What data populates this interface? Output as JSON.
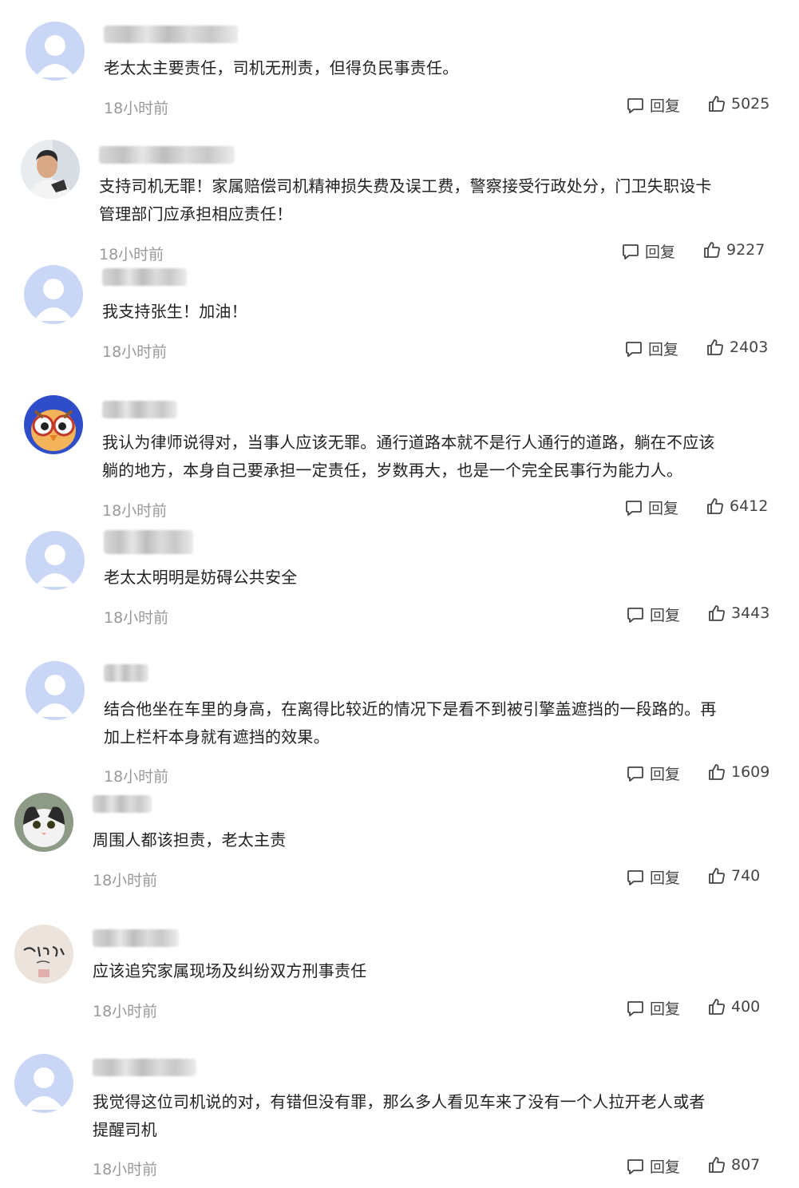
{
  "labels": {
    "reply": "回复"
  },
  "colors": {
    "avatar_default_bg": "#c9d6f5",
    "avatar_default_fg": "#ffffff",
    "time": "#999999",
    "text": "#222222"
  },
  "comments": [
    {
      "avatar": "default-avatar-icon",
      "text_lines": [
        "老太太主要责任，司机无刑责，但得负民事责任。"
      ],
      "time": "18小时前",
      "likes": "5025"
    },
    {
      "avatar": "man-photo-avatar",
      "text_lines": [
        "支持司机无罪！家属赔偿司机精神损失费及误工费，警察接受行政处分，门卫失职设卡",
        "管理部门应承担相应责任！"
      ],
      "time": "18小时前",
      "likes": "9227"
    },
    {
      "avatar": "default-avatar-icon",
      "text_lines": [
        "我支持张生！加油！"
      ],
      "time": "18小时前",
      "likes": "2403"
    },
    {
      "avatar": "owl-cartoon-avatar",
      "text_lines": [
        "我认为律师说得对，当事人应该无罪。通行道路本就不是行人通行的道路，躺在不应该",
        "躺的地方，本身自己要承担一定责任，岁数再大，也是一个完全民事行为能力人。"
      ],
      "time": "18小时前",
      "likes": "6412"
    },
    {
      "avatar": "default-avatar-icon",
      "text_lines": [
        "老太太明明是妨碍公共安全"
      ],
      "time": "18小时前",
      "likes": "3443"
    },
    {
      "avatar": "default-avatar-icon",
      "text_lines": [
        "结合他坐在车里的身高，在离得比较近的情况下是看不到被引擎盖遮挡的一段路的。再",
        "加上栏杆本身就有遮挡的效果。"
      ],
      "time": "18小时前",
      "likes": "1609"
    },
    {
      "avatar": "cat-photo-avatar",
      "text_lines": [
        "周围人都该担责，老太主责"
      ],
      "time": "18小时前",
      "likes": "740"
    },
    {
      "avatar": "handwriting-avatar",
      "text_lines": [
        "应该追究家属现场及纠纷双方刑事责任"
      ],
      "time": "18小时前",
      "likes": "400"
    },
    {
      "avatar": "default-avatar-icon",
      "text_lines": [
        "我觉得这位司机说的对，有错但没有罪，那么多人看见车来了没有一个人拉开老人或者",
        "提醒司机"
      ],
      "time": "18小时前",
      "likes": "807"
    }
  ]
}
